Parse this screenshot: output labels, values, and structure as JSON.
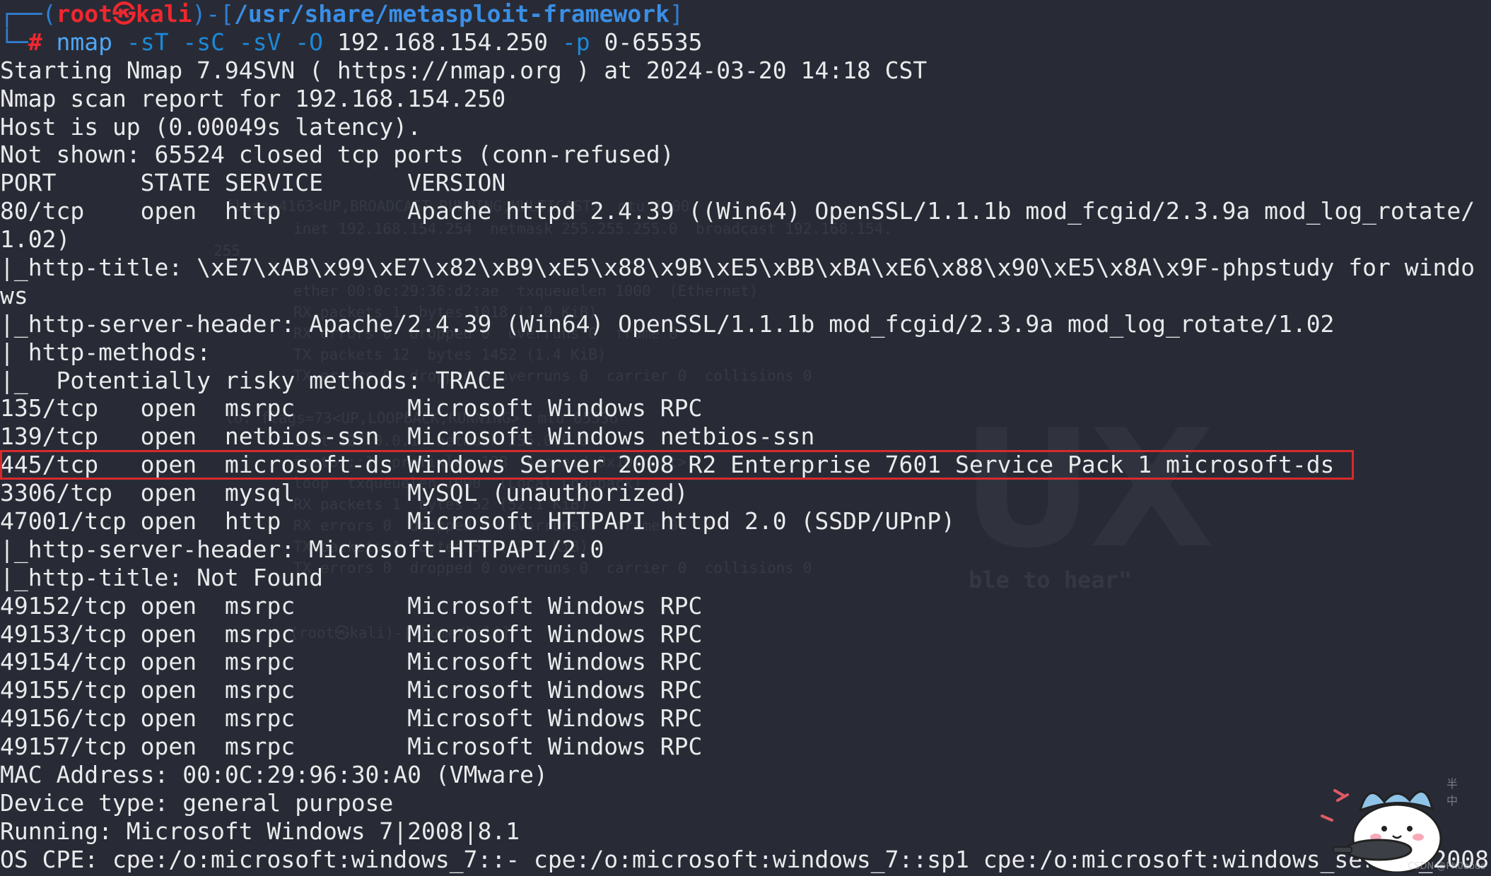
{
  "prompt": {
    "open": "┌──(",
    "user": "root",
    "at_symbol": "㉿",
    "host": "kali",
    "mid": ")-[",
    "path": "/usr/share/metasploit-framework",
    "close": "]",
    "second_prefix": "└─",
    "hash": "#"
  },
  "command": {
    "program": "nmap",
    "flag1": "-sT",
    "flag2": "-sC",
    "flag3": "-sV",
    "flag4": "-O",
    "target": "192.168.154.250",
    "flag5": "-p",
    "range": "0-65535"
  },
  "output": [
    "Starting Nmap 7.94SVN ( https://nmap.org ) at 2024-03-20 14:18 CST",
    "Nmap scan report for 192.168.154.250",
    "Host is up (0.00049s latency).",
    "Not shown: 65524 closed tcp ports (conn-refused)",
    "PORT      STATE SERVICE      VERSION",
    "80/tcp    open  http         Apache httpd 2.4.39 ((Win64) OpenSSL/1.1.1b mod_fcgid/2.3.9a mod_log_rotate/",
    "1.02)",
    "|_http-title: \\xE7\\xAB\\x99\\xE7\\x82\\xB9\\xE5\\x88\\x9B\\xE5\\xBB\\xBA\\xE6\\x88\\x90\\xE5\\x8A\\x9F-phpstudy for windo",
    "ws",
    "|_http-server-header: Apache/2.4.39 (Win64) OpenSSL/1.1.1b mod_fcgid/2.3.9a mod_log_rotate/1.02",
    "| http-methods: ",
    "|_  Potentially risky methods: TRACE",
    "135/tcp   open  msrpc        Microsoft Windows RPC",
    "139/tcp   open  netbios-ssn  Microsoft Windows netbios-ssn",
    "445/tcp   open  microsoft-ds Windows Server 2008 R2 Enterprise 7601 Service Pack 1 microsoft-ds",
    "3306/tcp  open  mysql        MySQL (unauthorized)",
    "47001/tcp open  http         Microsoft HTTPAPI httpd 2.0 (SSDP/UPnP)",
    "|_http-server-header: Microsoft-HTTPAPI/2.0",
    "|_http-title: Not Found",
    "49152/tcp open  msrpc        Microsoft Windows RPC",
    "49153/tcp open  msrpc        Microsoft Windows RPC",
    "49154/tcp open  msrpc        Microsoft Windows RPC",
    "49155/tcp open  msrpc        Microsoft Windows RPC",
    "49156/tcp open  msrpc        Microsoft Windows RPC",
    "49157/tcp open  msrpc        Microsoft Windows RPC",
    "MAC Address: 00:0C:29:96:30:A0 (VMware)",
    "Device type: general purpose",
    "Running: Microsoft Windows 7|2008|8.1",
    "OS CPE: cpe:/o:microsoft:windows_7::- cpe:/o:microsoft:windows_7::sp1 cpe:/o:microsoft:windows_server_2008"
  ],
  "highlighted_line_index": 14,
  "ghost_text": [
    "flags=4163<UP,BROADCAST,RUNNING,MULTICAST>  mtu 1500",
    "inet 192.168.154.254  netmask 255.255.255.0  broadcast 192.168.154.",
    "255",
    "ether 00:0c:29:36:d2:ae  txqueuelen 1000  (Ethernet)",
    "RX packets 1  bytes 1018 (1.0 KiB)",
    "RX errors 0  dropped 0  overruns 0  frame 0",
    "TX packets 12  bytes 1452 (1.4 KiB)",
    "TX errors 0  dropped 0 overruns 0  carrier 0  collisions 0",
    "lo: flags=73<UP,LOOPBACK,RUNNING>  mtu 65536",
    "inet 127.0.0.1  netmask 255.0.0.0",
    "inet6 ::1  prefixlen 128  scopeid 0x10<host>",
    "loop  txqueuelen 1000  (Local Loopback)",
    "RX packets 1  bytes 52 (52.1 KiB)",
    "RX errors 0  dropped 0  overruns 0  frame 0",
    "TX packets 1  bytes 52 (52.1 KiB)",
    "TX errors 0  dropped 0 overruns 0  carrier 0  collisions 0",
    "(root㉿kali)-[/home/kali]"
  ],
  "ghost_logo": "UX",
  "ghost_slogan": "ble to hear\"",
  "watermark": "CSDN @Ph0ebus",
  "colors": {
    "background": "#282b35",
    "text": "#e9eaec",
    "prompt_red": "#f0272f",
    "prompt_blue": "#2f7fd6",
    "highlight_border": "#d82a2e"
  }
}
